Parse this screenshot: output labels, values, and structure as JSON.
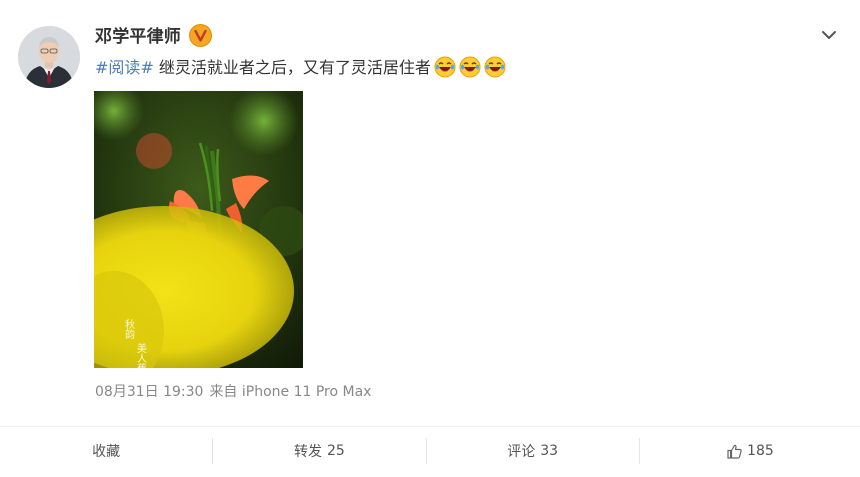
{
  "post": {
    "author": {
      "name": "邓学平律师",
      "avatar_icon": "person-avatar",
      "verified_icon": "verified-v-badge"
    },
    "text": {
      "hashtag": "#阅读#",
      "body": " 继灵活就业者之后，又有了灵活居住者",
      "emojis": [
        "laughing-crying-emoji",
        "laughing-crying-emoji",
        "laughing-crying-emoji"
      ]
    },
    "image": {
      "caption_left": "秋韵",
      "caption_right": "美人蕉"
    },
    "meta": {
      "time": "08月31日 19:30",
      "source": "来自 iPhone 11 Pro Max"
    }
  },
  "actions": {
    "favorite_label": "收藏",
    "repost_label": "转发",
    "repost_count": "25",
    "comment_label": "评论",
    "comment_count": "33",
    "like_count": "185"
  },
  "colors": {
    "hashtag": "#4b7db8",
    "badge": "#f5a623",
    "meta_text": "#888888"
  }
}
